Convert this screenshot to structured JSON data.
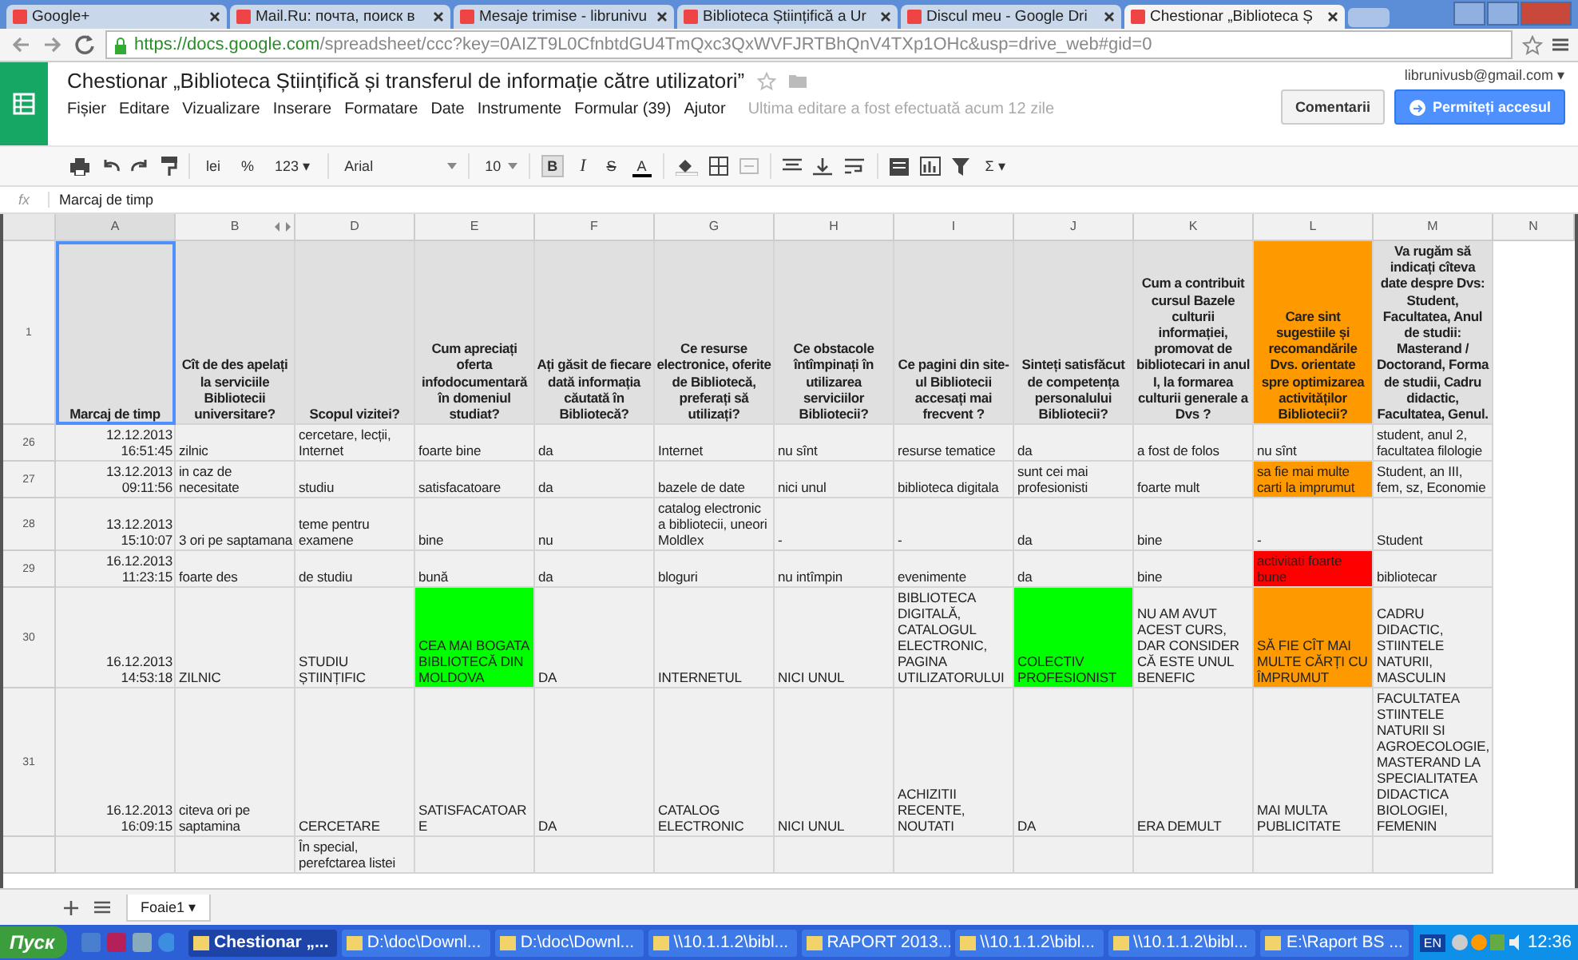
{
  "browser_tabs": [
    {
      "label": "Google+",
      "selected": false
    },
    {
      "label": "Mail.Ru: почта, поиск в",
      "selected": false
    },
    {
      "label": "Mesaje trimise - librunivu",
      "selected": false
    },
    {
      "label": "Biblioteca Științifică a Ur",
      "selected": false
    },
    {
      "label": "Discul meu - Google Dri",
      "selected": false
    },
    {
      "label": "Chestionar „Biblioteca Ș",
      "selected": true
    }
  ],
  "url": {
    "host": "https://docs.google.com",
    "path": "/spreadsheet/ccc?key=0AIZT9L0CfnbtdGU4TmQxc3QxWVFJRTBhQnV4TXp1OHc&usp=drive_web#gid=0"
  },
  "document": {
    "title": "Chestionar „Biblioteca Științifică și transferul de informație către utilizatori”",
    "account": "librunivusb@gmail.com ▾",
    "comments_button": "Comentarii",
    "share_button": "Permiteți accesul",
    "last_edit": "Ultima editare a fost efectuată acum 12 zile"
  },
  "menu": [
    "Fișier",
    "Editare",
    "Vizualizare",
    "Inserare",
    "Formatare",
    "Date",
    "Instrumente",
    "Formular (39)",
    "Ajutor"
  ],
  "toolbar": {
    "currency": "lei",
    "percent": "%",
    "number_format": "123 ▾",
    "font": "Arial",
    "font_size": "10",
    "bold": "B",
    "bold_on": true,
    "italic": "I",
    "strike": "S",
    "text_color": "A",
    "functions": "Σ ▾"
  },
  "formula_bar": {
    "label": "fx",
    "value": "Marcaj de timp"
  },
  "columns": [
    "A",
    "B",
    "D",
    "E",
    "F",
    "G",
    "H",
    "I",
    "J",
    "K",
    "L",
    "M",
    "N"
  ],
  "header_row": {
    "number": "1",
    "cells": [
      {
        "text": "Marcaj de timp",
        "selected": true
      },
      {
        "text": "Cît de des apelați la serviciile Bibliotecii universitare?",
        "selected": false
      },
      {
        "text": "Scopul vizitei?",
        "selected": false
      },
      {
        "text": "Cum apreciați oferta infodocumentară în domeniul studiat?",
        "selected": false
      },
      {
        "text": "Ați găsit de fiecare dată informația căutată în Bibliotecă?",
        "selected": false
      },
      {
        "text": "Ce resurse electronice, oferite de Bibliotecă, preferați să utilizați?",
        "selected": false
      },
      {
        "text": "Ce obstacole întîmpinați în utilizarea serviciilor Bibliotecii?",
        "selected": false
      },
      {
        "text": "Ce pagini din site-ul Bibliotecii accesați mai frecvent ?",
        "selected": false
      },
      {
        "text": "Sinteți satisfăcut de competența personalului Bibliotecii?",
        "selected": false
      },
      {
        "text": "Cum a contribuit cursul Bazele culturii informației, promovat de bibliotecari in anul I, la formarea culturii generale a Dvs ?",
        "selected": false
      },
      {
        "text": "Care sint sugestiile și recomandările Dvs. orientate spre optimizarea activităților Bibliotecii?",
        "selected": false,
        "color": "#ff9900"
      },
      {
        "text": "Va rugăm să indicați cîteva date despre Dvs: Student, Facultatea, Anul de studii: Masterand / Doctorand, Forma de studii, Cadru didactic, Facultatea, Genul.",
        "selected": false
      }
    ]
  },
  "rows": [
    {
      "number": "26",
      "cells": [
        {
          "text": "12.12.2013 16:51:45"
        },
        {
          "text": "zilnic"
        },
        {
          "text": "cercetare, lecții, Internet"
        },
        {
          "text": "foarte bine"
        },
        {
          "text": "da"
        },
        {
          "text": "Internet"
        },
        {
          "text": "nu sînt"
        },
        {
          "text": "resurse tematice"
        },
        {
          "text": "da"
        },
        {
          "text": "a fost de folos"
        },
        {
          "text": "nu sînt"
        },
        {
          "text": "student, anul 2, facultatea filologie"
        }
      ]
    },
    {
      "number": "27",
      "cells": [
        {
          "text": "13.12.2013 09:11:56"
        },
        {
          "text": "in caz de necesitate"
        },
        {
          "text": "studiu"
        },
        {
          "text": "satisfacatoare"
        },
        {
          "text": "da"
        },
        {
          "text": "bazele de date"
        },
        {
          "text": "nici unul"
        },
        {
          "text": "biblioteca digitala"
        },
        {
          "text": "sunt cei mai profesionisti"
        },
        {
          "text": "foarte mult"
        },
        {
          "text": "sa fie mai multe carti la imprumut",
          "color": "#ff9900"
        },
        {
          "text": "Student, an III, fem, sz, Economie"
        }
      ]
    },
    {
      "number": "28",
      "cells": [
        {
          "text": "13.12.2013 15:10:07"
        },
        {
          "text": "3 ori pe saptamana"
        },
        {
          "text": "teme pentru examene"
        },
        {
          "text": "bine"
        },
        {
          "text": "nu"
        },
        {
          "text": "catalog electronic a bibliotecii, uneori Moldlex"
        },
        {
          "text": "-"
        },
        {
          "text": "-"
        },
        {
          "text": "da"
        },
        {
          "text": "bine"
        },
        {
          "text": "-"
        },
        {
          "text": "Student"
        }
      ]
    },
    {
      "number": "29",
      "cells": [
        {
          "text": "16.12.2013 11:23:15"
        },
        {
          "text": "foarte des"
        },
        {
          "text": "de studiu"
        },
        {
          "text": "bună"
        },
        {
          "text": "da"
        },
        {
          "text": "bloguri"
        },
        {
          "text": "nu intîmpin"
        },
        {
          "text": "evenimente"
        },
        {
          "text": "da"
        },
        {
          "text": "bine"
        },
        {
          "text": "activitati foarte bune",
          "color": "#ff0000"
        },
        {
          "text": "bibliotecar"
        }
      ]
    },
    {
      "number": "30",
      "cells": [
        {
          "text": "16.12.2013 14:53:18"
        },
        {
          "text": "ZILNIC"
        },
        {
          "text": "STUDIU ȘTIINȚIFIC"
        },
        {
          "text": "CEA MAI BOGATA BIBLIOTECĂ DIN MOLDOVA",
          "color": "#00ff00"
        },
        {
          "text": "DA"
        },
        {
          "text": "INTERNETUL"
        },
        {
          "text": "NICI UNUL"
        },
        {
          "text": "BIBLIOTECA DIGITALĂ, CATALOGUL ELECTRONIC, PAGINA UTILIZATORULUI"
        },
        {
          "text": "COLECTIV PROFESIONIST",
          "color": "#00ff00"
        },
        {
          "text": "NU AM AVUT ACEST CURS, DAR CONSIDER CĂ ESTE UNUL BENEFIC"
        },
        {
          "text": "SĂ FIE CÎT MAI MULTE CĂRȚI CU ÎMPRUMUT",
          "color": "#ff9900"
        },
        {
          "text": "CADRU DIDACTIC, STIINTELE NATURII, MASCULIN"
        }
      ]
    },
    {
      "number": "31",
      "cells": [
        {
          "text": "16.12.2013 16:09:15"
        },
        {
          "text": "citeva ori pe saptamina"
        },
        {
          "text": "CERCETARE"
        },
        {
          "text": "SATISFACATOARE"
        },
        {
          "text": "DA"
        },
        {
          "text": "CATALOG ELECTRONIC"
        },
        {
          "text": "NICI UNUL"
        },
        {
          "text": "ACHIZIΤII RECENTE, NOUTATI"
        },
        {
          "text": "DA"
        },
        {
          "text": "ERA DEMULT"
        },
        {
          "text": "MAI MULTA PUBLICITATE"
        },
        {
          "text": "FACULTATEA STIINTELE NATURII SI AGROECOLOGIE, MASTERAND LA SPECIALITATEA DIDACTICA BIOLOGIEI, FEMENIN"
        }
      ]
    },
    {
      "cells": [
        {},
        {},
        {
          "text": "În special, perefctarea listei"
        },
        {},
        {},
        {},
        {},
        {},
        {},
        {},
        {},
        {}
      ]
    }
  ],
  "sheet_tabs": [
    {
      "label": "Foaie1 ▾",
      "selected": true
    }
  ],
  "taskbar": {
    "start": "Пуск",
    "tasks": [
      {
        "label": "Chestionar „...",
        "selected": true
      },
      {
        "label": "D:\\doc\\Downl...",
        "selected": false
      },
      {
        "label": "D:\\doc\\Downl...",
        "selected": false
      },
      {
        "label": "\\\\10.1.1.2\\bibl...",
        "selected": false
      },
      {
        "label": "RAPORT 2013...",
        "selected": false
      },
      {
        "label": "\\\\10.1.1.2\\bibl...",
        "selected": false
      },
      {
        "label": "\\\\10.1.1.2\\bibl...",
        "selected": false
      },
      {
        "label": "E:\\Raport BS ...",
        "selected": false
      }
    ],
    "language": "EN",
    "clock": "12:36"
  }
}
